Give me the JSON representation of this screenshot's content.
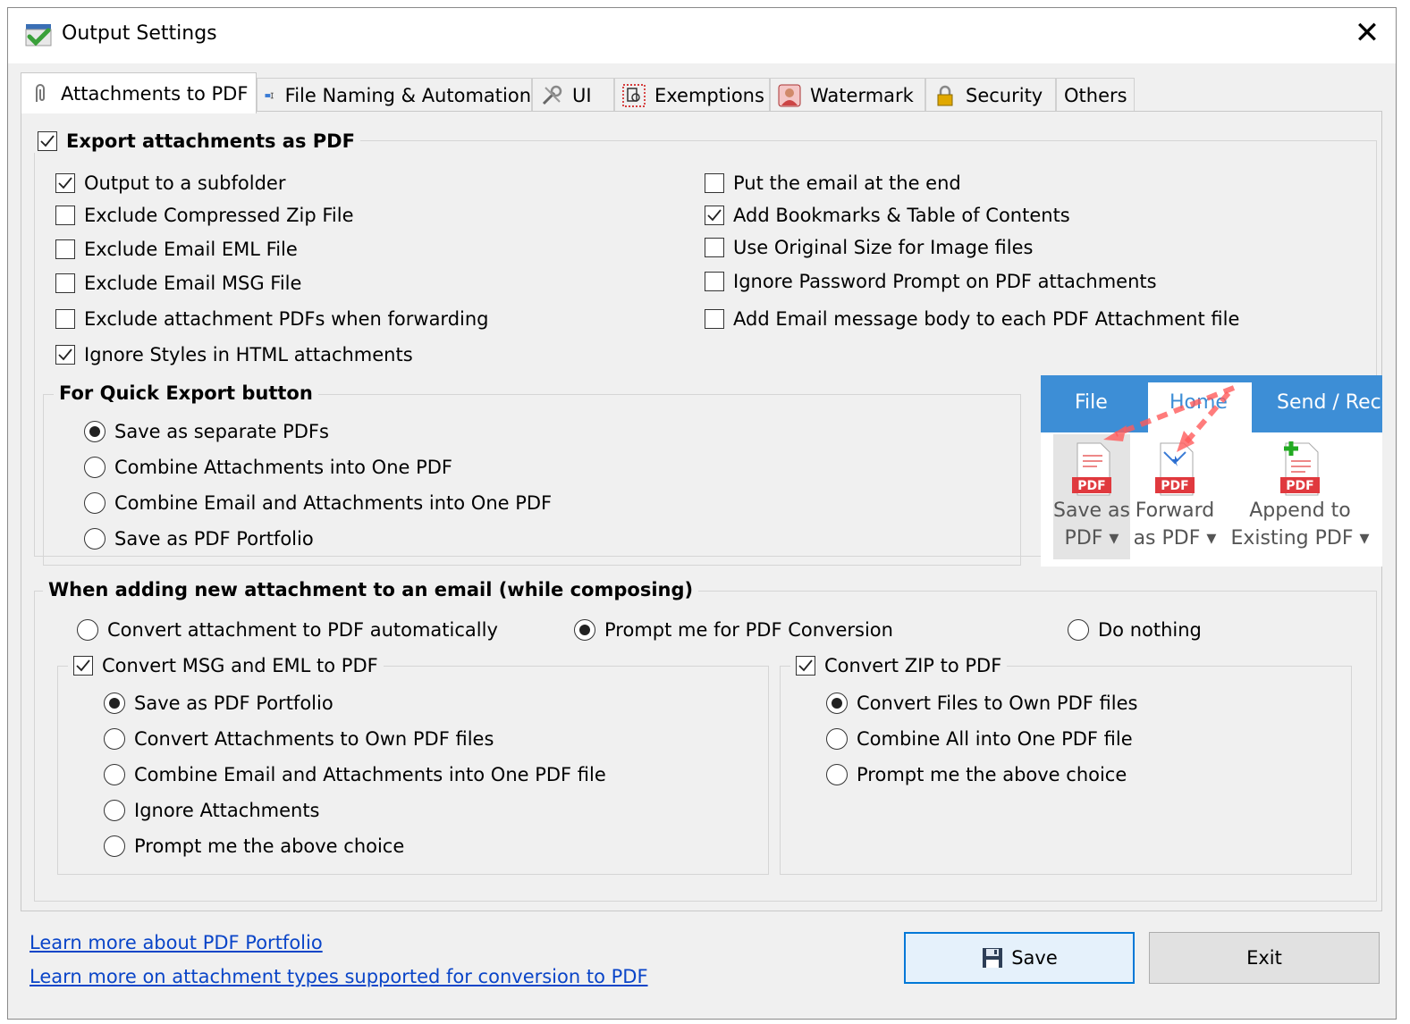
{
  "window": {
    "title": "Output Settings"
  },
  "tabs": [
    {
      "label": "Attachments to PDF"
    },
    {
      "label": "File Naming & Automation"
    },
    {
      "label": "UI"
    },
    {
      "label": "Exemptions"
    },
    {
      "label": "Watermark"
    },
    {
      "label": "Security"
    },
    {
      "label": "Others"
    }
  ],
  "export": {
    "label": "Export attachments as PDF",
    "checked": true,
    "left_options": [
      {
        "label": "Output to a subfolder",
        "checked": true
      },
      {
        "label": "Exclude Compressed Zip File",
        "checked": false
      },
      {
        "label": "Exclude Email EML File",
        "checked": false
      },
      {
        "label": "Exclude Email MSG File",
        "checked": false
      },
      {
        "label": "Exclude attachment PDFs when forwarding",
        "checked": false
      },
      {
        "label": "Ignore Styles in HTML attachments",
        "checked": true
      }
    ],
    "right_options": [
      {
        "label": "Put the email at the end",
        "checked": false
      },
      {
        "label": "Add Bookmarks & Table of Contents",
        "checked": true
      },
      {
        "label": "Use Original Size for Image files",
        "checked": false
      },
      {
        "label": "Ignore Password Prompt on PDF attachments",
        "checked": false
      },
      {
        "label": "Add Email message body to each PDF Attachment file",
        "checked": false
      }
    ]
  },
  "quick_export": {
    "title": "For Quick Export button",
    "options": [
      {
        "label": "Save as separate PDFs",
        "selected": true
      },
      {
        "label": "Combine Attachments into One PDF",
        "selected": false
      },
      {
        "label": "Combine Email and Attachments into One PDF",
        "selected": false
      },
      {
        "label": "Save as PDF Portfolio",
        "selected": false
      }
    ]
  },
  "ribbon": {
    "tabs": {
      "file": "File",
      "home": "Home",
      "send": "Send / Rece"
    },
    "buttons": [
      {
        "line1": "Save as",
        "line2": "PDF ▾"
      },
      {
        "line1": "Forward",
        "line2": "as PDF ▾"
      },
      {
        "line1": "Append to",
        "line2": "Existing PDF ▾"
      }
    ],
    "icon_text": "PDF"
  },
  "composing": {
    "title": "When adding new attachment to an email (while composing)",
    "options": [
      {
        "label": "Convert attachment to PDF automatically",
        "selected": false
      },
      {
        "label": "Prompt me for PDF Conversion",
        "selected": true
      },
      {
        "label": "Do nothing",
        "selected": false
      }
    ],
    "msg_eml": {
      "label": "Convert MSG and EML to PDF",
      "checked": true,
      "options": [
        {
          "label": "Save as PDF Portfolio",
          "selected": true
        },
        {
          "label": "Convert Attachments to Own PDF files",
          "selected": false
        },
        {
          "label": "Combine Email and Attachments into One PDF file",
          "selected": false
        },
        {
          "label": "Ignore Attachments",
          "selected": false
        },
        {
          "label": "Prompt me the above choice",
          "selected": false
        }
      ]
    },
    "zip": {
      "label": "Convert ZIP to PDF",
      "checked": true,
      "options": [
        {
          "label": "Convert Files to Own PDF files",
          "selected": true
        },
        {
          "label": "Combine All into One PDF file",
          "selected": false
        },
        {
          "label": "Prompt me the above choice",
          "selected": false
        }
      ]
    }
  },
  "links": {
    "portfolio": "Learn more about PDF Portfolio",
    "types": "Learn more on attachment types supported for conversion to PDF"
  },
  "buttons": {
    "save": "Save",
    "exit": "Exit"
  },
  "colors": {
    "accent": "#0078d7",
    "ribbon_blue": "#3d8ed6",
    "pdf_red": "#e0393e",
    "link": "#0a45c8"
  }
}
